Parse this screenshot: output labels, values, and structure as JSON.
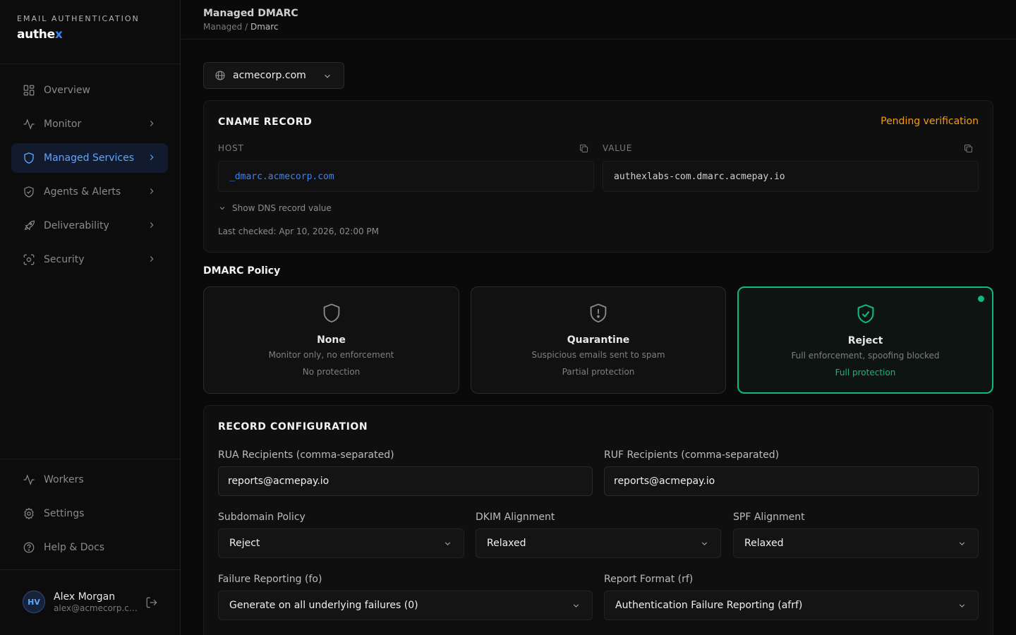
{
  "brand": {
    "kicker": "EMAIL AUTHENTICATION",
    "logo_main": "authe",
    "logo_accent": "x"
  },
  "sidebar": {
    "items": [
      {
        "label": "Overview",
        "icon": "grid-icon"
      },
      {
        "label": "Monitor",
        "icon": "activity-icon"
      },
      {
        "label": "Managed Services",
        "icon": "shield-icon",
        "active": true
      },
      {
        "label": "Agents & Alerts",
        "icon": "shield-check-icon"
      },
      {
        "label": "Deliverability",
        "icon": "rocket-icon"
      },
      {
        "label": "Security",
        "icon": "scan-icon"
      }
    ],
    "bottom_items": [
      {
        "label": "Workers",
        "icon": "activity-icon"
      },
      {
        "label": "Settings",
        "icon": "gear-icon"
      },
      {
        "label": "Help & Docs",
        "icon": "help-circle-icon"
      }
    ],
    "user": {
      "initials": "HV",
      "name": "Alex Morgan",
      "email": "alex@acmecorp.com"
    }
  },
  "header": {
    "title": "Managed DMARC",
    "breadcrumb_parent": "Managed",
    "breadcrumb_sep": "/",
    "breadcrumb_current": "Dmarc"
  },
  "domain_select": {
    "value": "acmecorp.com"
  },
  "cname": {
    "title": "CNAME RECORD",
    "status": "Pending verification",
    "host_label": "HOST",
    "host_value": "_dmarc.acmecorp.com",
    "value_label": "VALUE",
    "value_value": "authexlabs-com.dmarc.acmepay.io",
    "show_dns": "Show DNS record value",
    "last_checked": "Last checked: Apr 10, 2026, 02:00 PM"
  },
  "policy": {
    "heading": "DMARC Policy",
    "options": [
      {
        "name": "None",
        "description": "Monitor only, no enforcement",
        "protection": "No protection"
      },
      {
        "name": "Quarantine",
        "description": "Suspicious emails sent to spam",
        "protection": "Partial protection"
      },
      {
        "name": "Reject",
        "description": "Full enforcement, spoofing blocked",
        "protection": "Full protection",
        "selected": true
      }
    ]
  },
  "config": {
    "title": "RECORD CONFIGURATION",
    "rua_label": "RUA Recipients (comma-separated)",
    "rua_value": "reports@acmepay.io",
    "ruf_label": "RUF Recipients (comma-separated)",
    "ruf_value": "reports@acmepay.io",
    "subdomain_label": "Subdomain Policy",
    "subdomain_value": "Reject",
    "dkim_label": "DKIM Alignment",
    "dkim_value": "Relaxed",
    "spf_label": "SPF Alignment",
    "spf_value": "Relaxed",
    "fo_label": "Failure Reporting (fo)",
    "fo_value": "Generate on all underlying failures (0)",
    "rf_label": "Report Format (rf)",
    "rf_value": "Authentication Failure Reporting (afrf)"
  },
  "colors": {
    "accent": "#3b82f6",
    "success": "#10b981",
    "warning": "#f59e0b",
    "background": "#0a0a0a"
  }
}
